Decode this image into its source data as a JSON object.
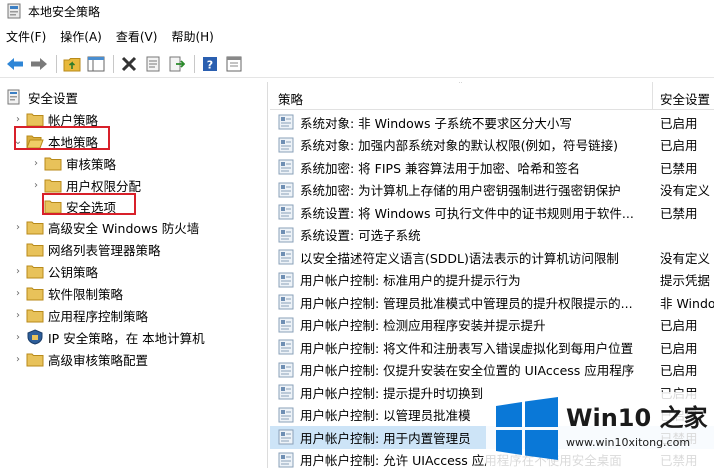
{
  "window": {
    "title": "本地安全策略"
  },
  "menu": [
    "文件(F)",
    "操作(A)",
    "查看(V)",
    "帮助(H)"
  ],
  "tree": {
    "root": "安全设置",
    "items": [
      {
        "label": "帐户策略"
      },
      {
        "label": "本地策略"
      },
      {
        "label": "审核策略"
      },
      {
        "label": "用户权限分配"
      },
      {
        "label": "安全选项"
      },
      {
        "label": "高级安全 Windows 防火墙"
      },
      {
        "label": "网络列表管理器策略"
      },
      {
        "label": "公钥策略"
      },
      {
        "label": "软件限制策略"
      },
      {
        "label": "应用程序控制策略"
      },
      {
        "label": "IP 安全策略，在 本地计算机"
      },
      {
        "label": "高级审核策略配置"
      }
    ]
  },
  "list": {
    "col_policy": "策略",
    "col_setting": "安全设置",
    "rows": [
      {
        "policy": "系统对象: 非 Windows 子系统不要求区分大小写",
        "setting": "已启用"
      },
      {
        "policy": "系统对象: 加强内部系统对象的默认权限(例如，符号链接)",
        "setting": "已启用"
      },
      {
        "policy": "系统加密: 将 FIPS 兼容算法用于加密、哈希和签名",
        "setting": "已禁用"
      },
      {
        "policy": "系统加密: 为计算机上存储的用户密钥强制进行强密钥保护",
        "setting": "没有定义"
      },
      {
        "policy": "系统设置: 将 Windows 可执行文件中的证书规则用于软件...",
        "setting": "已禁用"
      },
      {
        "policy": "系统设置: 可选子系统",
        "setting": ""
      },
      {
        "policy": "以安全描述符定义语言(SDDL)语法表示的计算机访问限制",
        "setting": "没有定义"
      },
      {
        "policy": "用户帐户控制: 标准用户的提升提示行为",
        "setting": "提示凭据"
      },
      {
        "policy": "用户帐户控制: 管理员批准模式中管理员的提升权限提示的...",
        "setting": "非 Windows"
      },
      {
        "policy": "用户帐户控制: 检测应用程序安装并提示提升",
        "setting": "已启用"
      },
      {
        "policy": "用户帐户控制: 将文件和注册表写入错误虚拟化到每用户位置",
        "setting": "已启用"
      },
      {
        "policy": "用户帐户控制: 仅提升安装在安全位置的 UIAccess 应用程序",
        "setting": "已启用"
      },
      {
        "policy": "用户帐户控制: 提示提升时切换到",
        "setting": "已启用"
      },
      {
        "policy": "用户帐户控制: 以管理员批准模",
        "setting": "已启用"
      },
      {
        "policy": "用户帐户控制: 用于内置管理员",
        "setting": "已禁用"
      },
      {
        "policy": "用户帐户控制: 允许 UIAccess 应用程序在不使用安全桌面",
        "setting": "已禁用"
      }
    ]
  },
  "watermark": {
    "brand": "Win10 之家",
    "url": "www.win10xitong.com"
  },
  "colors": {
    "highlight_box": "#d8202a",
    "selection": "#cde4f7",
    "win_logo": "#0a78d7"
  }
}
